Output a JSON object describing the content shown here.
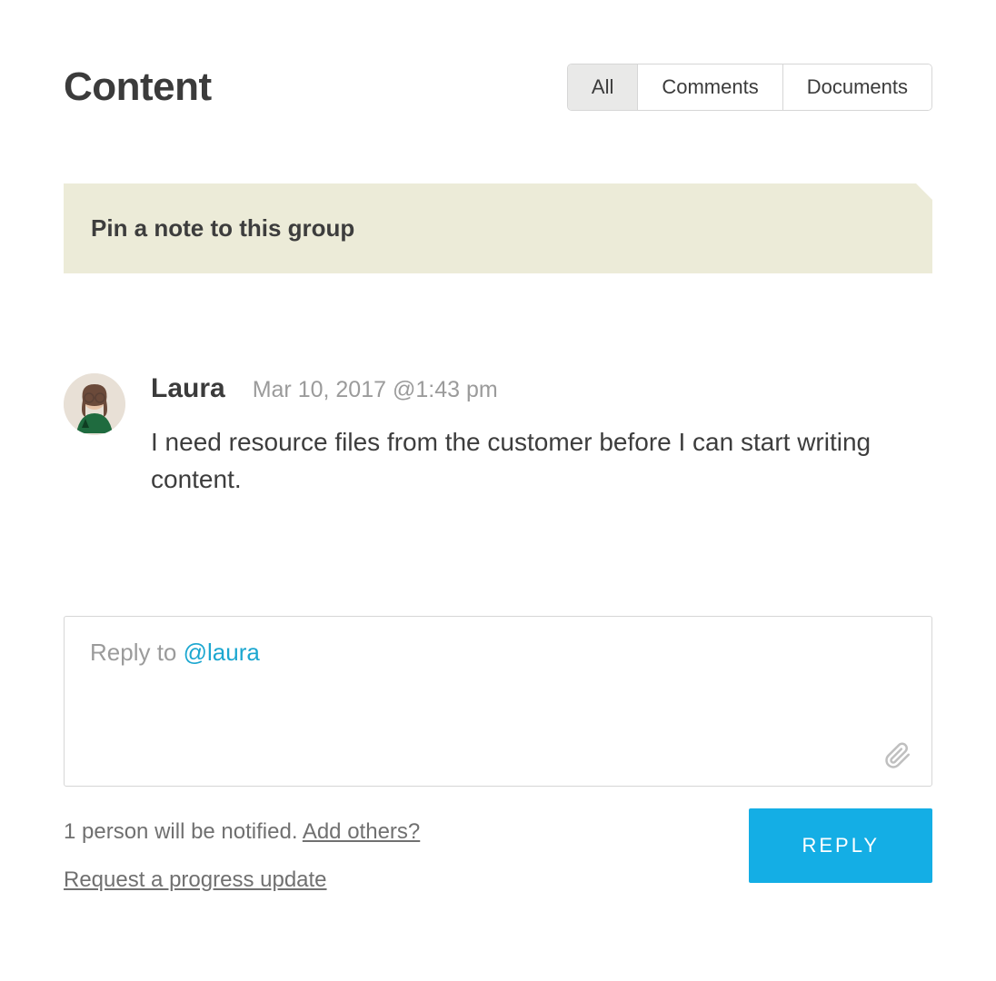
{
  "header": {
    "title": "Content",
    "tabs": [
      {
        "label": "All",
        "active": true
      },
      {
        "label": "Comments",
        "active": false
      },
      {
        "label": "Documents",
        "active": false
      }
    ]
  },
  "pinNote": {
    "text": "Pin a note to this group"
  },
  "comment": {
    "author": "Laura",
    "timestamp": "Mar 10, 2017 @1:43 pm",
    "body": "I need resource files from the customer before I can start writing content."
  },
  "reply": {
    "placeholderPrefix": "Reply to ",
    "mention": "@laura",
    "notifyText": "1 person will be notified.  ",
    "addOthers": "Add others?",
    "requestUpdate": "Request a progress update",
    "buttonLabel": "REPLY"
  }
}
